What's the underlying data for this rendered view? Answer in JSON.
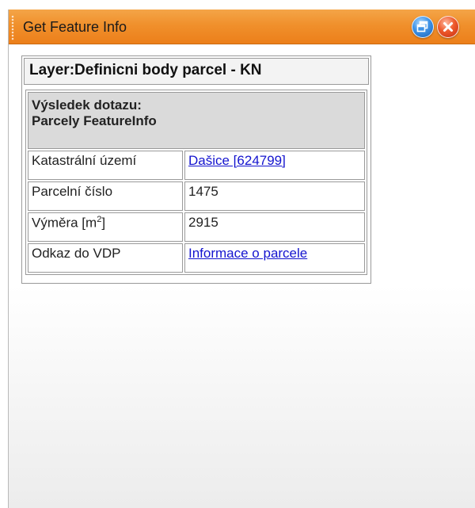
{
  "window": {
    "title": "Get Feature Info",
    "buttons": {
      "restore_icon": "restore-window-icon",
      "close_icon": "close-icon"
    }
  },
  "layer": {
    "heading": "Layer:Definicni body parcel - KN"
  },
  "result": {
    "header_line1": "Výsledek dotazu:",
    "header_line2": "Parcely FeatureInfo",
    "rows": [
      {
        "key": "Katastrální území",
        "value": "Dašice [624799]",
        "link": true
      },
      {
        "key": "Parcelní číslo",
        "value": "1475",
        "link": false
      },
      {
        "key": "Výměra [m",
        "key_sup": "2",
        "key_end": "]",
        "value": "2915",
        "link": false
      },
      {
        "key": "Odkaz do VDP",
        "value": "Informace o parcele",
        "link": true
      }
    ]
  },
  "colors": {
    "titlebar": "#f0902c",
    "link": "#1414cf",
    "header_cell": "#dadada"
  }
}
